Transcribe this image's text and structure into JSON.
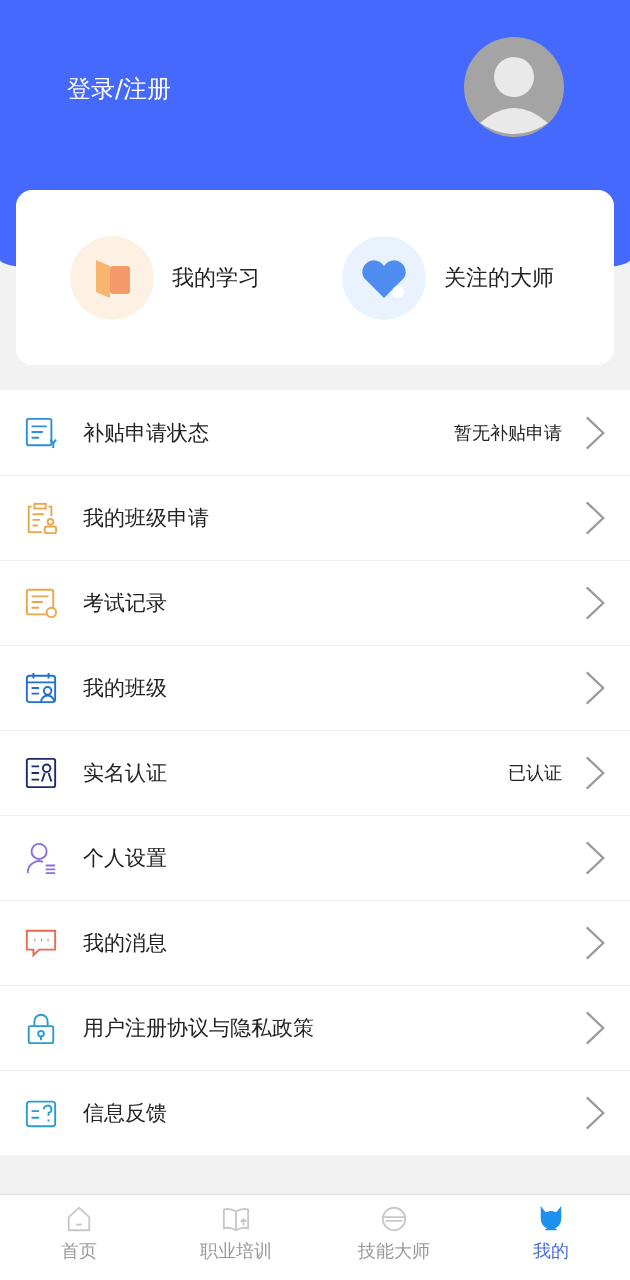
{
  "header": {
    "login": "登录/注册"
  },
  "shortcuts": [
    {
      "kind": "study",
      "label": "我的学习"
    },
    {
      "kind": "follow",
      "label": "关注的大师"
    }
  ],
  "menu": [
    {
      "kind": "subsidy",
      "label": "补贴申请状态",
      "value": "暂无补贴申请"
    },
    {
      "kind": "class-apply",
      "label": "我的班级申请"
    },
    {
      "kind": "exam",
      "label": "考试记录"
    },
    {
      "kind": "class",
      "label": "我的班级"
    },
    {
      "kind": "realname",
      "label": "实名认证",
      "value": "已认证"
    },
    {
      "kind": "settings",
      "label": "个人设置"
    },
    {
      "kind": "message",
      "label": "我的消息"
    },
    {
      "kind": "privacy",
      "label": "用户注册协议与隐私政策"
    },
    {
      "kind": "feedback",
      "label": "信息反馈"
    }
  ],
  "tabs": [
    {
      "kind": "home",
      "label": "首页",
      "selected": false
    },
    {
      "kind": "training",
      "label": "职业培训",
      "selected": false
    },
    {
      "kind": "master",
      "label": "技能大师",
      "selected": false
    },
    {
      "kind": "mine",
      "label": "我的",
      "selected": true
    }
  ]
}
